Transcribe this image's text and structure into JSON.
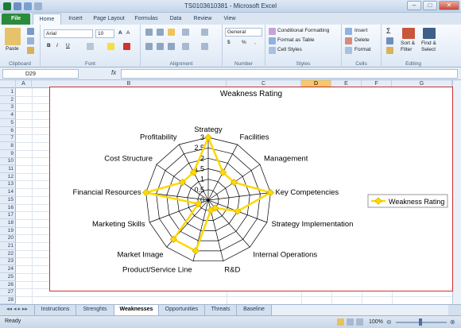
{
  "window": {
    "title": "TS0103610381 - Microsoft Excel"
  },
  "tabs": [
    "File",
    "Home",
    "Insert",
    "Page Layout",
    "Formulas",
    "Data",
    "Review",
    "View"
  ],
  "ribbon": {
    "clipboard": {
      "label": "Clipboard",
      "paste": "Paste"
    },
    "font": {
      "label": "Font",
      "name": "Arial",
      "size": "10",
      "bold": "B",
      "italic": "I",
      "underline": "U"
    },
    "alignment": {
      "label": "Alignment"
    },
    "number": {
      "label": "Number",
      "format": "General",
      "currency": "$",
      "percent": "%",
      "comma": ","
    },
    "styles": {
      "label": "Styles",
      "conditional": "Conditional Formatting",
      "format_table": "Format as Table",
      "cell_styles": "Cell Styles"
    },
    "cells": {
      "label": "Cells",
      "insert": "Insert",
      "delete": "Delete",
      "format": "Format"
    },
    "editing": {
      "label": "Editing",
      "sum": "Σ",
      "sort": "Sort &",
      "sort2": "Filter",
      "find": "Find &",
      "find2": "Select"
    }
  },
  "formula_bar": {
    "name_box": "D29",
    "fx": "fx",
    "formula": ""
  },
  "columns": [
    "A",
    "B",
    "C",
    "D",
    "E",
    "F",
    "G"
  ],
  "selected_column": "D",
  "rows": [
    "1",
    "2",
    "3",
    "4",
    "5",
    "6",
    "7",
    "8",
    "9",
    "10",
    "11",
    "12",
    "13",
    "14",
    "15",
    "16",
    "17",
    "18",
    "19",
    "20",
    "21",
    "22",
    "23",
    "24",
    "25",
    "26",
    "27",
    "28"
  ],
  "chart_data": {
    "type": "radar",
    "title": "Weakness Rating",
    "categories": [
      "Strategy",
      "Facilities",
      "Management",
      "Key Competencies",
      "Strategy Implementation",
      "Internal Operations",
      "R&D",
      "Product/Service Line",
      "Market Image",
      "Marketing Skills",
      "Financial Resources",
      "Cost Structure",
      "Profitability"
    ],
    "series": [
      {
        "name": "Weakness Rating",
        "values": [
          3,
          1.5,
          1.5,
          3,
          1.5,
          0.5,
          0.5,
          2.5,
          2.5,
          0.5,
          3,
          1.5,
          1.5
        ]
      }
    ],
    "ticks": [
      "0",
      "0.5",
      "1",
      "1.5",
      "2",
      "2.5",
      "3"
    ],
    "rmax": 3,
    "legend": "right",
    "line_color": "#ffd800",
    "marker_color": "#ffd800"
  },
  "sheet_tabs": [
    "Instructions",
    "Strenghts",
    "Weaknesses",
    "Opportunities",
    "Threats",
    "Baseline"
  ],
  "active_sheet": "Weaknesses",
  "status": {
    "left": "Ready",
    "zoom": "100%"
  }
}
